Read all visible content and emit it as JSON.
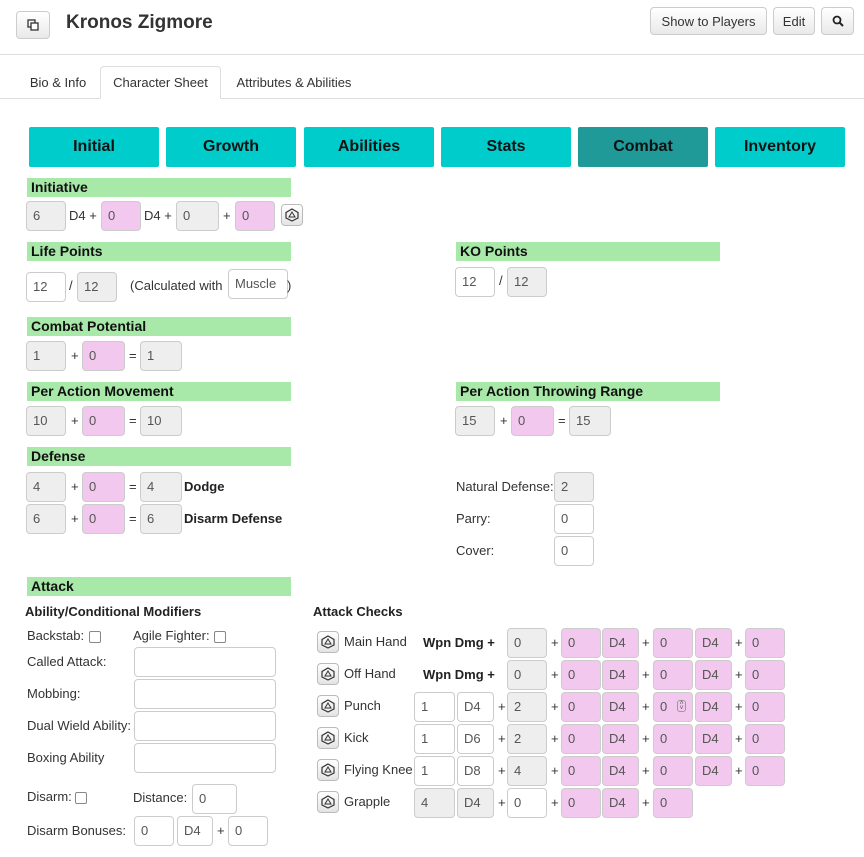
{
  "header": {
    "title": "Kronos Zigmore",
    "show_to_players": "Show to Players",
    "edit": "Edit"
  },
  "tabs": [
    "Bio & Info",
    "Character Sheet",
    "Attributes & Abilities"
  ],
  "nav": [
    "Initial",
    "Growth",
    "Abilities",
    "Stats",
    "Combat",
    "Inventory"
  ],
  "initiative": {
    "title": "Initiative",
    "base": "6",
    "die1": "D4 +",
    "mod1": "0",
    "die2": "D4 +",
    "mod2": "0",
    "plus": "+",
    "mod3": "0"
  },
  "life": {
    "title": "Life Points",
    "current": "12",
    "sep": "/",
    "max": "12",
    "calc_label": "(Calculated with",
    "calc_attr": "Muscle",
    "close": ")"
  },
  "ko": {
    "title": "KO Points",
    "current": "12",
    "sep": "/",
    "max": "12"
  },
  "combat_potential": {
    "title": "Combat Potential",
    "base": "1",
    "plus": "+",
    "mod": "0",
    "eq": "=",
    "total": "1"
  },
  "movement": {
    "title": "Per Action Movement",
    "base": "10",
    "plus": "+",
    "mod": "0",
    "eq": "=",
    "total": "10"
  },
  "throwing": {
    "title": "Per Action Throwing Range",
    "base": "15",
    "plus": "+",
    "mod": "0",
    "eq": "=",
    "total": "15"
  },
  "defense": {
    "title": "Defense",
    "dodge": {
      "base": "4",
      "plus": "+",
      "mod": "0",
      "eq": "=",
      "total": "4",
      "label": "Dodge"
    },
    "disarm": {
      "base": "6",
      "plus": "+",
      "mod": "0",
      "eq": "=",
      "total": "6",
      "label": "Disarm Defense"
    },
    "natural_label": "Natural Defense:",
    "natural": "2",
    "parry_label": "Parry:",
    "parry": "0",
    "cover_label": "Cover:",
    "cover": "0"
  },
  "attack": {
    "title": "Attack",
    "modifiers_title": "Ability/Conditional Modifiers",
    "backstab": "Backstab:",
    "agile": "Agile Fighter:",
    "called": "Called Attack:",
    "mobbing": "Mobbing:",
    "dual": "Dual Wield Ability:",
    "boxing": "Boxing Ability",
    "disarm": "Disarm:",
    "distance": "Distance:",
    "distance_value": "0",
    "bonuses": "Disarm Bonuses:",
    "bonus1": "0",
    "bonus_die": "D4",
    "bonus_plus": "+",
    "bonus2": "0",
    "checks_title": "Attack Checks",
    "plus": "+",
    "rows": [
      {
        "name": "Main Hand",
        "dmg_label": "Wpn Dmg +",
        "a": "0",
        "b": "0",
        "d1": "D4",
        "c": "0",
        "d2": "D4",
        "e": "0"
      },
      {
        "name": "Off Hand",
        "dmg_label": "Wpn Dmg +",
        "a": "0",
        "b": "0",
        "d1": "D4",
        "c": "0",
        "d2": "D4",
        "e": "0"
      },
      {
        "name": "Punch",
        "n": "1",
        "die": "D4",
        "a": "2",
        "b": "0",
        "d1": "D4",
        "c": "0",
        "d2": "D4",
        "e": "0"
      },
      {
        "name": "Kick",
        "n": "1",
        "die": "D6",
        "a": "2",
        "b": "0",
        "d1": "D4",
        "c": "0",
        "d2": "D4",
        "e": "0"
      },
      {
        "name": "Flying Knee",
        "n": "1",
        "die": "D8",
        "a": "4",
        "b": "0",
        "d1": "D4",
        "c": "0",
        "d2": "D4",
        "e": "0"
      },
      {
        "name": "Grapple",
        "n": "4",
        "die": "D4",
        "a": "0",
        "b": "0",
        "d1": "D4",
        "c": "0"
      }
    ]
  }
}
